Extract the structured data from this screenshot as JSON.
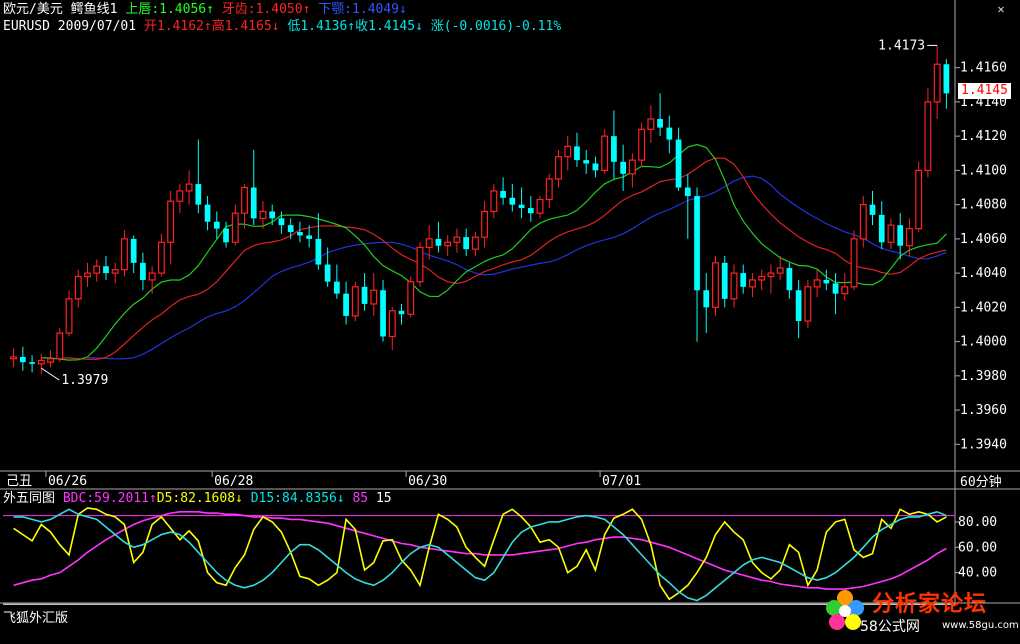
{
  "header": {
    "symbol_name": "欧元/美元",
    "indicator_name": "鳄鱼线1",
    "lips_label": "上唇:1.4056",
    "lips_arrow": "↑",
    "teeth_label": "牙齿:1.4050",
    "teeth_arrow": "↑",
    "jaw_label": "下颚:1.4049",
    "jaw_arrow": "↓",
    "symbol_code": "EURUSD",
    "date": "2009/07/01",
    "open_label": "开1.4162",
    "open_arrow": "↑",
    "high_label": "高1.4165",
    "high_arrow": "↓",
    "low_label": "低1.4136",
    "low_arrow": "↑",
    "close_label": "收1.4145",
    "close_arrow": "↓",
    "change_label": "涨(-0.0016)-0.11%"
  },
  "close_tag": "1.4145",
  "window": {
    "close_icon": "close-icon"
  },
  "sub_header": {
    "indicator_name": "外五同图",
    "bdc_label": "BDC:59.2011",
    "bdc_arrow": "↑",
    "d5_label": "D5:82.1608",
    "d5_arrow": "↓",
    "d15_label": "D15:84.8356",
    "d15_arrow": "↓",
    "level_a": "85",
    "level_b": "15"
  },
  "footer_label": "飞狐外汇版",
  "x_axis": {
    "left_label": "己丑",
    "dates": [
      "06/26",
      "06/28",
      "06/30",
      "07/01"
    ],
    "period_label": "60分钟"
  },
  "logo": {
    "name": "分析家论坛",
    "sub": "58公式网",
    "url_text": "www.58gu.com"
  },
  "colors": {
    "up_candle": "#ff2222",
    "down_candle": "#00ffff",
    "lips": "#22cc22",
    "teeth": "#dd2222",
    "jaw": "#2233dd",
    "bdc": "#ff33ff",
    "d5": "#ffff00",
    "d15": "#33dddd",
    "level_line": "#ff33ff",
    "axis": "#aaaaaa"
  },
  "chart_data": [
    {
      "type": "candlestick",
      "title": "EURUSD 60分钟",
      "y_ticks": [
        1.394,
        1.396,
        1.398,
        1.4,
        1.402,
        1.404,
        1.406,
        1.408,
        1.41,
        1.412,
        1.414,
        1.416
      ],
      "ylim": [
        1.3925,
        1.4182
      ],
      "annotations": [
        {
          "text": "1.3979"
        },
        {
          "text": "1.4173"
        }
      ],
      "candles": [
        [
          1.399,
          1.3996,
          1.3985,
          1.3991
        ],
        [
          1.3991,
          1.3997,
          1.3983,
          1.3988
        ],
        [
          1.3988,
          1.3992,
          1.3982,
          1.3987
        ],
        [
          1.3987,
          1.3993,
          1.3981,
          1.3989
        ],
        [
          1.3988,
          1.3995,
          1.3985,
          1.399
        ],
        [
          1.399,
          1.4008,
          1.3988,
          1.4005
        ],
        [
          1.4005,
          1.403,
          1.4003,
          1.4025
        ],
        [
          1.4025,
          1.4042,
          1.402,
          1.4038
        ],
        [
          1.4038,
          1.4046,
          1.4032,
          1.404
        ],
        [
          1.404,
          1.4048,
          1.4035,
          1.4044
        ],
        [
          1.4044,
          1.405,
          1.4036,
          1.404
        ],
        [
          1.404,
          1.4046,
          1.4034,
          1.4042
        ],
        [
          1.4042,
          1.4065,
          1.4038,
          1.406
        ],
        [
          1.406,
          1.4062,
          1.404,
          1.4046
        ],
        [
          1.4046,
          1.4052,
          1.403,
          1.4036
        ],
        [
          1.4036,
          1.4044,
          1.4028,
          1.404
        ],
        [
          1.404,
          1.4063,
          1.4038,
          1.4058
        ],
        [
          1.4058,
          1.4088,
          1.4045,
          1.4082
        ],
        [
          1.4082,
          1.4092,
          1.4075,
          1.4088
        ],
        [
          1.4088,
          1.41,
          1.408,
          1.4092
        ],
        [
          1.4092,
          1.4118,
          1.4075,
          1.408
        ],
        [
          1.408,
          1.4085,
          1.4065,
          1.407
        ],
        [
          1.407,
          1.4076,
          1.406,
          1.4066
        ],
        [
          1.4066,
          1.407,
          1.4055,
          1.4058
        ],
        [
          1.4058,
          1.408,
          1.4056,
          1.4075
        ],
        [
          1.4075,
          1.4092,
          1.4066,
          1.409
        ],
        [
          1.409,
          1.4112,
          1.4068,
          1.4072
        ],
        [
          1.4072,
          1.4082,
          1.4066,
          1.4076
        ],
        [
          1.4076,
          1.408,
          1.4068,
          1.4072
        ],
        [
          1.4072,
          1.4076,
          1.4063,
          1.4068
        ],
        [
          1.4068,
          1.4072,
          1.406,
          1.4064
        ],
        [
          1.4064,
          1.407,
          1.4058,
          1.4062
        ],
        [
          1.4062,
          1.4068,
          1.4055,
          1.406
        ],
        [
          1.406,
          1.4075,
          1.4042,
          1.4045
        ],
        [
          1.4045,
          1.4055,
          1.4032,
          1.4035
        ],
        [
          1.4035,
          1.4045,
          1.4025,
          1.4028
        ],
        [
          1.4028,
          1.4035,
          1.401,
          1.4015
        ],
        [
          1.4015,
          1.4035,
          1.4012,
          1.4032
        ],
        [
          1.4032,
          1.404,
          1.4018,
          1.4022
        ],
        [
          1.4022,
          1.404,
          1.4015,
          1.403
        ],
        [
          1.403,
          1.4036,
          1.4,
          1.4003
        ],
        [
          1.4003,
          1.402,
          1.3995,
          1.4018
        ],
        [
          1.4018,
          1.4022,
          1.401,
          1.4016
        ],
        [
          1.4016,
          1.4038,
          1.4014,
          1.4035
        ],
        [
          1.4035,
          1.4058,
          1.4032,
          1.4055
        ],
        [
          1.4055,
          1.4068,
          1.4048,
          1.406
        ],
        [
          1.406,
          1.407,
          1.4052,
          1.4056
        ],
        [
          1.4056,
          1.4062,
          1.405,
          1.4058
        ],
        [
          1.4058,
          1.4066,
          1.4052,
          1.4061
        ],
        [
          1.4061,
          1.4066,
          1.405,
          1.4054
        ],
        [
          1.4054,
          1.4064,
          1.405,
          1.4061
        ],
        [
          1.4061,
          1.4082,
          1.4055,
          1.4076
        ],
        [
          1.4076,
          1.4092,
          1.4072,
          1.4088
        ],
        [
          1.4088,
          1.4096,
          1.408,
          1.4084
        ],
        [
          1.4084,
          1.4092,
          1.4076,
          1.408
        ],
        [
          1.408,
          1.409,
          1.4072,
          1.4078
        ],
        [
          1.4078,
          1.4085,
          1.407,
          1.4075
        ],
        [
          1.4075,
          1.4085,
          1.4072,
          1.4083
        ],
        [
          1.4083,
          1.4098,
          1.4078,
          1.4095
        ],
        [
          1.4095,
          1.4112,
          1.409,
          1.4108
        ],
        [
          1.4108,
          1.412,
          1.41,
          1.4114
        ],
        [
          1.4114,
          1.4122,
          1.4102,
          1.4106
        ],
        [
          1.4106,
          1.4112,
          1.4098,
          1.4104
        ],
        [
          1.4104,
          1.4108,
          1.4096,
          1.41
        ],
        [
          1.41,
          1.4124,
          1.4098,
          1.412
        ],
        [
          1.412,
          1.4135,
          1.4095,
          1.4105
        ],
        [
          1.4105,
          1.4115,
          1.4088,
          1.4098
        ],
        [
          1.4098,
          1.411,
          1.409,
          1.4106
        ],
        [
          1.4106,
          1.4128,
          1.4102,
          1.4124
        ],
        [
          1.4124,
          1.4138,
          1.4116,
          1.413
        ],
        [
          1.413,
          1.4145,
          1.412,
          1.4125
        ],
        [
          1.4125,
          1.4132,
          1.411,
          1.4118
        ],
        [
          1.4118,
          1.4125,
          1.4088,
          1.409
        ],
        [
          1.409,
          1.4098,
          1.406,
          1.4085
        ],
        [
          1.4085,
          1.409,
          1.4,
          1.403
        ],
        [
          1.403,
          1.404,
          1.4005,
          1.402
        ],
        [
          1.402,
          1.405,
          1.4015,
          1.4046
        ],
        [
          1.4046,
          1.405,
          1.402,
          1.4025
        ],
        [
          1.4025,
          1.4045,
          1.402,
          1.404
        ],
        [
          1.404,
          1.4045,
          1.4028,
          1.4032
        ],
        [
          1.4032,
          1.404,
          1.4026,
          1.4036
        ],
        [
          1.4036,
          1.4042,
          1.403,
          1.4038
        ],
        [
          1.4038,
          1.4045,
          1.4028,
          1.404
        ],
        [
          1.404,
          1.405,
          1.4036,
          1.4043
        ],
        [
          1.4043,
          1.4046,
          1.4025,
          1.403
        ],
        [
          1.403,
          1.4036,
          1.4002,
          1.4012
        ],
        [
          1.4012,
          1.4036,
          1.4008,
          1.4032
        ],
        [
          1.4032,
          1.4042,
          1.4026,
          1.4036
        ],
        [
          1.4036,
          1.4042,
          1.403,
          1.4034
        ],
        [
          1.4034,
          1.404,
          1.4016,
          1.4028
        ],
        [
          1.4028,
          1.404,
          1.4024,
          1.4032
        ],
        [
          1.4032,
          1.4065,
          1.403,
          1.406
        ],
        [
          1.406,
          1.4085,
          1.4055,
          1.408
        ],
        [
          1.408,
          1.4088,
          1.4068,
          1.4074
        ],
        [
          1.4074,
          1.4082,
          1.4054,
          1.4058
        ],
        [
          1.4058,
          1.4072,
          1.4054,
          1.4068
        ],
        [
          1.4068,
          1.4075,
          1.4048,
          1.4056
        ],
        [
          1.4056,
          1.4072,
          1.405,
          1.4066
        ],
        [
          1.4066,
          1.4105,
          1.4064,
          1.41
        ],
        [
          1.41,
          1.4148,
          1.4096,
          1.414
        ],
        [
          1.414,
          1.4173,
          1.413,
          1.4162
        ],
        [
          1.4162,
          1.4165,
          1.4136,
          1.4145
        ]
      ]
    },
    {
      "type": "line",
      "title": "外五同图",
      "y_ticks": [
        40,
        60,
        80
      ],
      "ylim": [
        16,
        91
      ],
      "levels": [
        85,
        15
      ],
      "series": [
        {
          "name": "BDC",
          "values": [
            30,
            32,
            34,
            35,
            38,
            40,
            45,
            50,
            56,
            61,
            66,
            70,
            74,
            78,
            81,
            83,
            85,
            87,
            88,
            88,
            88,
            87,
            87,
            86,
            86,
            85,
            84,
            84,
            83,
            83,
            82,
            82,
            81,
            80,
            79,
            77,
            75,
            73,
            71,
            69,
            67,
            65,
            63,
            62,
            60,
            59,
            58,
            57,
            56,
            55,
            55,
            54,
            54,
            54,
            54,
            55,
            56,
            57,
            58,
            59,
            61,
            63,
            64,
            66,
            67,
            68,
            68,
            67,
            66,
            64,
            62,
            60,
            57,
            54,
            51,
            48,
            45,
            42,
            40,
            38,
            36,
            34,
            33,
            31,
            30,
            29,
            28,
            28,
            27,
            27,
            27,
            28,
            29,
            31,
            33,
            35,
            38,
            42,
            46,
            50,
            55,
            59
          ]
        },
        {
          "name": "D5",
          "values": [
            75,
            70,
            65,
            78,
            72,
            62,
            54,
            86,
            91,
            90,
            86,
            84,
            78,
            48,
            56,
            78,
            84,
            75,
            66,
            73,
            65,
            40,
            32,
            30,
            44,
            54,
            74,
            84,
            80,
            72,
            56,
            37,
            35,
            30,
            34,
            40,
            82,
            74,
            42,
            48,
            65,
            66,
            50,
            42,
            30,
            60,
            86,
            82,
            76,
            60,
            52,
            45,
            66,
            86,
            90,
            84,
            76,
            64,
            66,
            60,
            40,
            45,
            58,
            42,
            70,
            83,
            86,
            90,
            82,
            62,
            30,
            19,
            24,
            30,
            40,
            52,
            70,
            80,
            72,
            66,
            48,
            40,
            35,
            42,
            62,
            56,
            30,
            42,
            72,
            80,
            82,
            58,
            52,
            55,
            82,
            75,
            90,
            86,
            88,
            86,
            80,
            84
          ]
        },
        {
          "name": "D15",
          "values": [
            84,
            84,
            82,
            80,
            82,
            86,
            90,
            86,
            84,
            82,
            76,
            70,
            64,
            60,
            62,
            66,
            70,
            72,
            70,
            64,
            56,
            48,
            40,
            34,
            30,
            28,
            30,
            34,
            40,
            48,
            56,
            62,
            62,
            58,
            52,
            46,
            40,
            35,
            32,
            30,
            34,
            40,
            48,
            55,
            60,
            62,
            60,
            54,
            48,
            42,
            36,
            34,
            40,
            52,
            64,
            72,
            76,
            78,
            80,
            80,
            82,
            84,
            85,
            84,
            82,
            76,
            70,
            62,
            54,
            46,
            38,
            32,
            25,
            20,
            18,
            22,
            28,
            34,
            40,
            46,
            50,
            52,
            50,
            48,
            44,
            40,
            36,
            34,
            36,
            40,
            46,
            52,
            60,
            68,
            74,
            78,
            82,
            84,
            84,
            86,
            88,
            85
          ]
        }
      ]
    }
  ]
}
